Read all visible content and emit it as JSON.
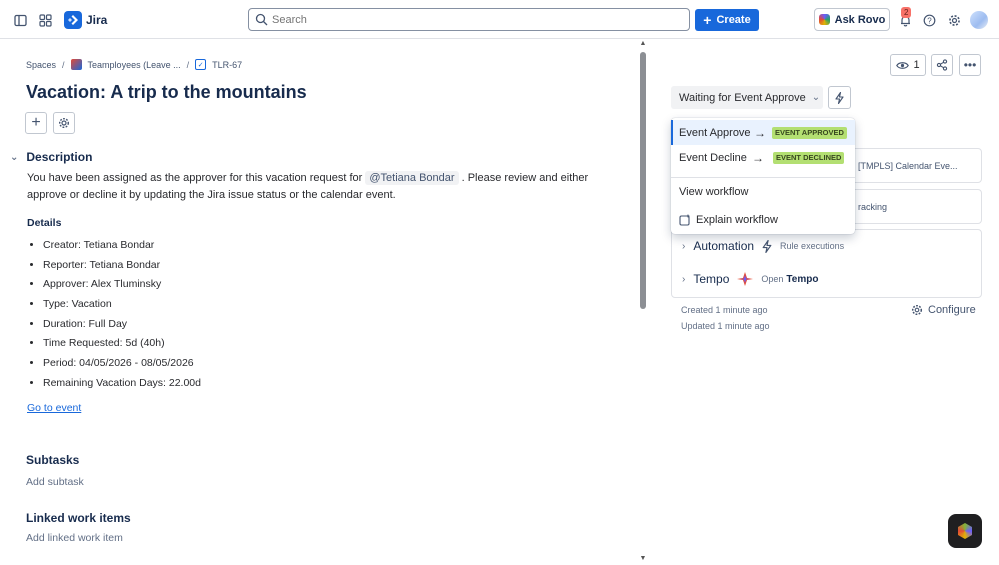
{
  "app": {
    "name": "Jira"
  },
  "search": {
    "placeholder": "Search"
  },
  "topbar": {
    "create_label": "Create",
    "ask_rovo_label": "Ask Rovo",
    "notification_count": "2"
  },
  "breadcrumb": {
    "spaces": "Spaces",
    "project": "Teamployees (Leave ...",
    "issue_key": "TLR-67"
  },
  "issue": {
    "title": "Vacation: A trip to the mountains"
  },
  "description": {
    "heading": "Description",
    "text_before": "You have been assigned as the approver for this vacation request for ",
    "mention": "@Tetiana Bondar",
    "text_after": " . Please review and either approve or decline it by updating the Jira issue status or the calendar event.",
    "details_heading": "Details",
    "details": [
      "Creator: Tetiana Bondar",
      "Reporter: Tetiana Bondar",
      "Approver: Alex Tluminsky",
      "Type: Vacation",
      "Duration: Full Day",
      "Time Requested: 5d (40h)",
      "Period: 04/05/2026 - 08/05/2026",
      "Remaining Vacation Days: 22.00d"
    ],
    "link_label": "Go to event"
  },
  "subtasks": {
    "heading": "Subtasks",
    "add_label": "Add subtask"
  },
  "linked": {
    "heading": "Linked work items",
    "add_label": "Add linked work item"
  },
  "right_panel": {
    "watchers_count": "1",
    "status_label": "Waiting for Event Approve",
    "card1_partial": "[TMPLS] Calendar Eve...",
    "card2_partial": "racking",
    "automation": {
      "title": "Automation",
      "sub": "Rule executions"
    },
    "tempo": {
      "title": "Tempo",
      "open": "Open",
      "brand": "Tempo"
    },
    "created": "Created 1 minute ago",
    "updated": "Updated 1 minute ago",
    "configure_label": "Configure"
  },
  "transitions_menu": {
    "items": [
      {
        "label": "Event Approve",
        "target": "EVENT APPROVED"
      },
      {
        "label": "Event Decline",
        "target": "EVENT DECLINED"
      }
    ],
    "view_workflow": "View workflow",
    "explain_workflow": "Explain workflow"
  },
  "colors": {
    "brand": "#1868db",
    "lozenge_success": "#b3df72",
    "text": "#172b4d"
  }
}
